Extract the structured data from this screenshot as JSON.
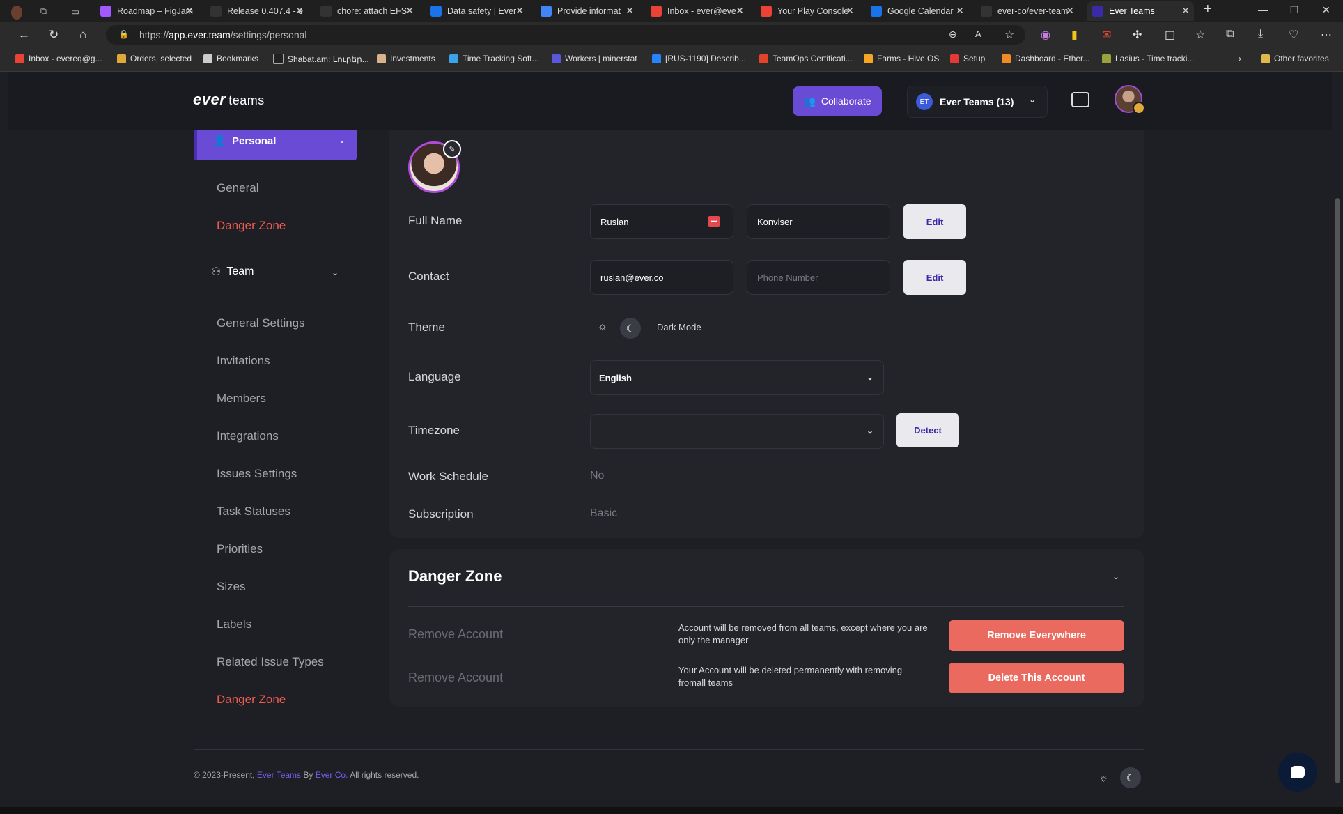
{
  "browser": {
    "tabs": [
      {
        "title": "Roadmap – FigJam",
        "fav_color": "#a259ff"
      },
      {
        "title": "Release 0.407.4 - e",
        "fav_color": "#333333"
      },
      {
        "title": "chore: attach EFS",
        "fav_color": "#333333"
      },
      {
        "title": "Data safety | Ever",
        "fav_color": "#1a73e8"
      },
      {
        "title": "Provide informat",
        "fav_color": "#4285f4"
      },
      {
        "title": "Inbox - ever@eve",
        "fav_color": "#ea4335"
      },
      {
        "title": "Your Play Console",
        "fav_color": "#ea4335"
      },
      {
        "title": "Google Calendar",
        "fav_color": "#1a73e8"
      },
      {
        "title": "ever-co/ever-team",
        "fav_color": "#333333"
      },
      {
        "title": "Ever Teams",
        "fav_color": "#3b2aa8"
      }
    ],
    "url_prefix": "https://",
    "url_host": "app.ever.team",
    "url_path": "/settings/personal",
    "bookmarks": [
      {
        "label": "Inbox - evereq@g...",
        "color": "#ea4335"
      },
      {
        "label": "Orders, selected",
        "color": "#e0a93a"
      },
      {
        "label": "Bookmarks",
        "color": "#cccccc"
      },
      {
        "label": "Shabat.am: Լուրեր...",
        "color": "#222222"
      },
      {
        "label": "Investments",
        "color": "#d9b38c"
      },
      {
        "label": "Time Tracking Soft...",
        "color": "#3ba4e8"
      },
      {
        "label": "Workers | minerstat",
        "color": "#5a57d8"
      },
      {
        "label": "[RUS-1190] Describ...",
        "color": "#2684ff"
      },
      {
        "label": "TeamOps Certificati...",
        "color": "#e24329"
      },
      {
        "label": "Farms - Hive OS",
        "color": "#f5a623"
      },
      {
        "label": "Setup",
        "color": "#e53935"
      },
      {
        "label": "Dashboard - Ether...",
        "color": "#f08a24"
      },
      {
        "label": "Lasius - Time tracki...",
        "color": "#9aa33b"
      },
      {
        "label": "Other favorites",
        "color": "#e0b84c"
      }
    ]
  },
  "header": {
    "logo_main": "ever",
    "logo_sub": "teams",
    "collaborate_label": "Collaborate",
    "team_badge": "ET",
    "team_name": "Ever Teams (13)"
  },
  "sidebar": {
    "personal_label": "Personal",
    "personal_items": [
      "General",
      "Danger Zone"
    ],
    "team_label": "Team",
    "team_items": [
      "General Settings",
      "Invitations",
      "Members",
      "Integrations",
      "Issues Settings",
      "Task Statuses",
      "Priorities",
      "Sizes",
      "Labels",
      "Related Issue Types",
      "Danger Zone"
    ]
  },
  "profile": {
    "full_name_label": "Full Name",
    "first_name": "Ruslan",
    "last_name": "Konviser",
    "edit_label": "Edit",
    "contact_label": "Contact",
    "email": "ruslan@ever.co",
    "phone_placeholder": "Phone Number",
    "theme_label": "Theme",
    "theme_value": "Dark Mode",
    "language_label": "Language",
    "language_value": "English",
    "timezone_label": "Timezone",
    "timezone_value": "",
    "detect_label": "Detect",
    "work_schedule_label": "Work Schedule",
    "work_schedule_value": "No",
    "subscription_label": "Subscription",
    "subscription_value": "Basic"
  },
  "danger": {
    "title": "Danger Zone",
    "rows": [
      {
        "label": "Remove Account",
        "desc": "Account will be removed from all teams, except where you are only the manager",
        "button": "Remove Everywhere"
      },
      {
        "label": "Remove Account",
        "desc": "Your Account will be deleted permanently with removing fromall teams",
        "button": "Delete This Account"
      }
    ]
  },
  "footer": {
    "prefix": "© 2023-Present,",
    "link1": "Ever Teams",
    "by": "By",
    "link2": "Ever Co.",
    "suffix": "All rights reserved."
  },
  "colors": {
    "accent": "#6a4bd5",
    "danger": "#eb6a5f",
    "danger_text": "#ef5b4f"
  }
}
